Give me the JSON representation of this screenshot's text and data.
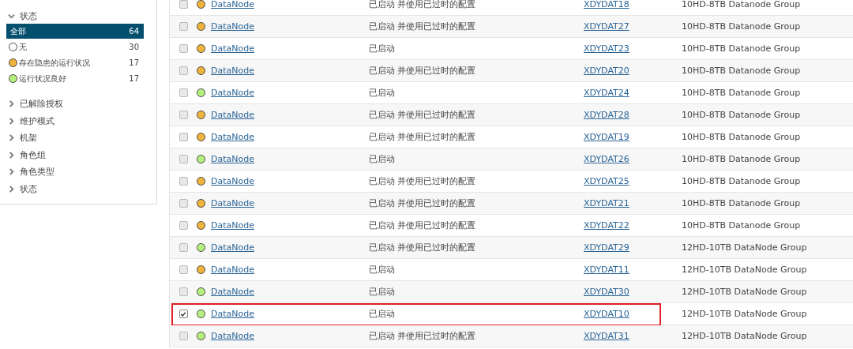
{
  "sidebar": {
    "status_filter": {
      "label": "状态",
      "expanded": true,
      "items": [
        {
          "label": "全部",
          "count": "64",
          "selected": true
        },
        {
          "label": "无",
          "count": "30",
          "selected": false,
          "color": "#ffffff"
        },
        {
          "label": "存在隐患的运行状况",
          "count": "17",
          "selected": false,
          "color": "#f0b43c"
        },
        {
          "label": "运行状况良好",
          "count": "17",
          "selected": false,
          "color": "#b6f07e"
        }
      ]
    },
    "groups": [
      {
        "label": "已解除授权",
        "expanded": false
      },
      {
        "label": "维护模式",
        "expanded": false
      },
      {
        "label": "机架",
        "expanded": false
      },
      {
        "label": "角色组",
        "expanded": false
      },
      {
        "label": "角色类型",
        "expanded": false
      },
      {
        "label": "状态",
        "expanded": false
      }
    ]
  },
  "table": {
    "rows": [
      {
        "checked": false,
        "highlighted": false,
        "color": "#f0b43c",
        "role": "DataNode",
        "status": "已启动 并使用已过时的配置",
        "host": "XDYDAT18",
        "group": "10HD-8TB Datanode Group"
      },
      {
        "checked": false,
        "highlighted": false,
        "color": "#f0b43c",
        "role": "DataNode",
        "status": "已启动 并使用已过时的配置",
        "host": "XDYDAT27",
        "group": "10HD-8TB Datanode Group"
      },
      {
        "checked": false,
        "highlighted": false,
        "color": "#f0b43c",
        "role": "DataNode",
        "status": "已启动",
        "host": "XDYDAT23",
        "group": "10HD-8TB Datanode Group"
      },
      {
        "checked": false,
        "highlighted": false,
        "color": "#f0b43c",
        "role": "DataNode",
        "status": "已启动 并使用已过时的配置",
        "host": "XDYDAT20",
        "group": "10HD-8TB Datanode Group"
      },
      {
        "checked": false,
        "highlighted": false,
        "color": "#b6f07e",
        "role": "DataNode",
        "status": "已启动",
        "host": "XDYDAT24",
        "group": "10HD-8TB Datanode Group"
      },
      {
        "checked": false,
        "highlighted": false,
        "color": "#f0b43c",
        "role": "DataNode",
        "status": "已启动 并使用已过时的配置",
        "host": "XDYDAT28",
        "group": "10HD-8TB Datanode Group"
      },
      {
        "checked": false,
        "highlighted": false,
        "color": "#f0b43c",
        "role": "DataNode",
        "status": "已启动 并使用已过时的配置",
        "host": "XDYDAT19",
        "group": "10HD-8TB Datanode Group"
      },
      {
        "checked": false,
        "highlighted": false,
        "color": "#b6f07e",
        "role": "DataNode",
        "status": "已启动",
        "host": "XDYDAT26",
        "group": "10HD-8TB Datanode Group"
      },
      {
        "checked": false,
        "highlighted": false,
        "color": "#f0b43c",
        "role": "DataNode",
        "status": "已启动 并使用已过时的配置",
        "host": "XDYDAT25",
        "group": "10HD-8TB Datanode Group"
      },
      {
        "checked": false,
        "highlighted": false,
        "color": "#f0b43c",
        "role": "DataNode",
        "status": "已启动 并使用已过时的配置",
        "host": "XDYDAT21",
        "group": "10HD-8TB Datanode Group"
      },
      {
        "checked": false,
        "highlighted": false,
        "color": "#f0b43c",
        "role": "DataNode",
        "status": "已启动 并使用已过时的配置",
        "host": "XDYDAT22",
        "group": "10HD-8TB Datanode Group"
      },
      {
        "checked": false,
        "highlighted": false,
        "color": "#b6f07e",
        "role": "DataNode",
        "status": "已启动 并使用已过时的配置",
        "host": "XDYDAT29",
        "group": "12HD-10TB DataNode Group"
      },
      {
        "checked": false,
        "highlighted": false,
        "color": "#f0b43c",
        "role": "DataNode",
        "status": "已启动",
        "host": "XDYDAT11",
        "group": "12HD-10TB DataNode Group"
      },
      {
        "checked": false,
        "highlighted": false,
        "color": "#b6f07e",
        "role": "DataNode",
        "status": "已启动",
        "host": "XDYDAT30",
        "group": "12HD-10TB DataNode Group"
      },
      {
        "checked": true,
        "highlighted": true,
        "color": "#b6f07e",
        "role": "DataNode",
        "status": "已启动",
        "host": "XDYDAT10",
        "group": "12HD-10TB DataNode Group"
      },
      {
        "checked": false,
        "highlighted": false,
        "color": "#b6f07e",
        "role": "DataNode",
        "status": "已启动 并使用已过时的配置",
        "host": "XDYDAT31",
        "group": "12HD-10TB DataNode Group"
      }
    ]
  }
}
